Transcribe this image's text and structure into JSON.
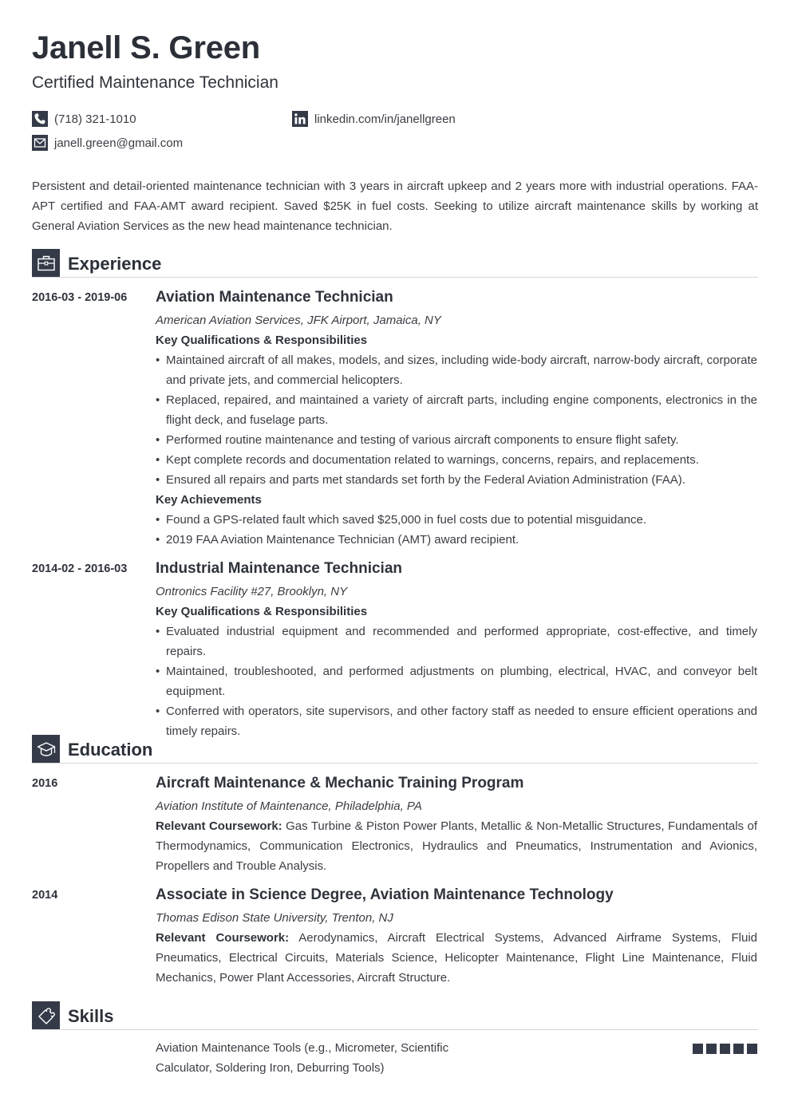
{
  "header": {
    "name": "Janell S. Green",
    "title": "Certified Maintenance Technician",
    "contacts": {
      "phone": {
        "icon": "phone-icon",
        "value": "(718) 321-1010"
      },
      "linkedin": {
        "icon": "linkedin-icon",
        "value": "linkedin.com/in/janellgreen"
      },
      "email": {
        "icon": "email-icon",
        "value": "janell.green@gmail.com"
      }
    }
  },
  "summary": "Persistent and detail-oriented maintenance technician with 3 years in aircraft upkeep and 2 years more with industrial operations. FAA-APT certified and FAA-AMT award recipient. Saved $25K in fuel costs. Seeking to utilize aircraft maintenance skills by working at General Aviation Services as the new head maintenance technician.",
  "experience": {
    "heading": "Experience",
    "icon": "briefcase-icon",
    "jobs": [
      {
        "dates": "2016-03 - 2019-06",
        "title": "Aviation Maintenance Technician",
        "org": "American Aviation Services, JFK Airport, Jamaica, NY",
        "sub1": "Key Qualifications & Responsibilities",
        "bullets1": [
          "Maintained aircraft of all makes, models, and sizes, including wide-body aircraft, narrow-body aircraft, corporate and private jets, and commercial helicopters.",
          "Replaced, repaired, and maintained a variety of aircraft parts, including engine components, electronics in the flight deck, and fuselage parts.",
          "Performed routine maintenance and testing of various aircraft components to ensure flight safety.",
          "Kept complete records and documentation related to warnings, concerns, repairs, and replacements.",
          "Ensured all repairs and parts met standards set forth by the Federal Aviation Administration (FAA)."
        ],
        "sub2": "Key Achievements",
        "bullets2": [
          "Found a GPS-related fault which saved $25,000 in fuel costs due to potential misguidance.",
          "2019 FAA Aviation Maintenance Technician (AMT) award recipient."
        ]
      },
      {
        "dates": "2014-02 - 2016-03",
        "title": "Industrial Maintenance Technician",
        "org": "Ontronics Facility #27, Brooklyn, NY",
        "sub1": "Key Qualifications & Responsibilities",
        "bullets1": [
          "Evaluated industrial equipment and recommended and performed appropriate, cost-effective, and timely repairs.",
          "Maintained, troubleshooted, and performed adjustments on plumbing, electrical, HVAC, and conveyor belt equipment.",
          "Conferred with operators, site supervisors, and other factory staff as needed to ensure efficient operations and timely repairs."
        ]
      }
    ]
  },
  "education": {
    "heading": "Education",
    "icon": "graduation-cap-icon",
    "items": [
      {
        "year": "2016",
        "title": "Aircraft Maintenance & Mechanic Training Program",
        "org": "Aviation Institute of Maintenance, Philadelphia, PA",
        "course_label": "Relevant Coursework:",
        "courses": "Gas Turbine & Piston Power Plants, Metallic & Non-Metallic Structures, Fundamentals of Thermodynamics, Communication Electronics, Hydraulics and Pneumatics, Instrumentation and Avionics, Propellers and Trouble Analysis."
      },
      {
        "year": "2014",
        "title": "Associate in Science Degree, Aviation Maintenance Technology",
        "org": "Thomas Edison State University, Trenton, NJ",
        "course_label": "Relevant Coursework:",
        "courses": "Aerodynamics, Aircraft Electrical Systems, Advanced Airframe Systems, Fluid Pneumatics, Electrical Circuits, Materials Science, Helicopter Maintenance, Flight Line Maintenance, Fluid Mechanics, Power Plant Accessories, Aircraft Structure."
      }
    ]
  },
  "skills": {
    "heading": "Skills",
    "icon": "puzzle-icon",
    "items": [
      {
        "name": "Aviation Maintenance Tools (e.g., Micrometer, Scientific Calculator, Soldering Iron, Deburring Tools)",
        "level": 5,
        "max": 5
      }
    ]
  },
  "colors": {
    "accent": "#343a48",
    "text": "#3a3d44",
    "rule": "#d6d6d6"
  }
}
